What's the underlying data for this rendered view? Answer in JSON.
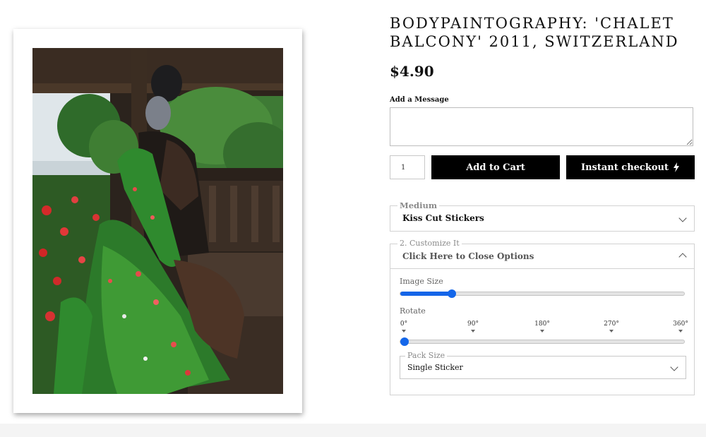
{
  "product": {
    "title": "BODYPAINTOGRAPHY: 'CHALET BALCONY' 2011, SWITZERLAND",
    "price": "$4.90"
  },
  "message": {
    "label": "Add a Message",
    "value": ""
  },
  "cart": {
    "quantity": "1",
    "add_to_cart_label": "Add to Cart",
    "instant_checkout_label": "Instant checkout",
    "instant_icon": "lightning-bolt-icon"
  },
  "medium": {
    "legend": "Medium",
    "selected": "Kiss Cut Stickers"
  },
  "customize": {
    "legend": "2. Customize It",
    "toggle_label": "Click Here to Close Options",
    "image_size": {
      "label": "Image Size",
      "value_fraction": 0.18
    },
    "rotate": {
      "label": "Rotate",
      "ticks": [
        "0°",
        "90°",
        "180°",
        "270°",
        "360°"
      ],
      "value_degrees": 0
    },
    "pack_size": {
      "legend": "Pack Size",
      "selected": "Single Sticker"
    }
  },
  "colors": {
    "button_bg": "#000000",
    "slider_accent": "#1565e8"
  }
}
